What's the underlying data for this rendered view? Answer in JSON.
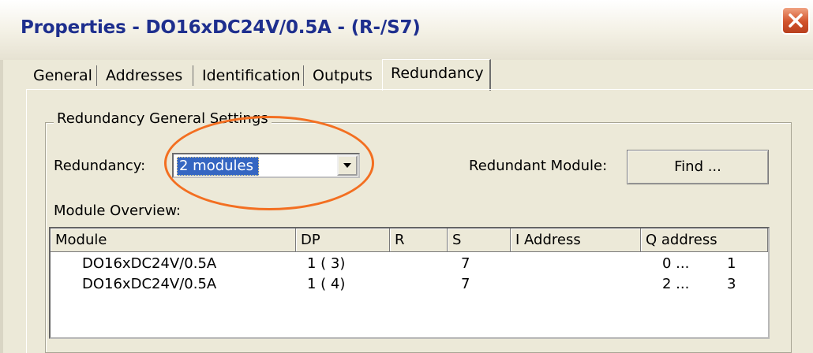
{
  "window": {
    "title": "Properties - DO16xDC24V/0.5A - (R-/S7)"
  },
  "tabs": [
    {
      "label": "General"
    },
    {
      "label": "Addresses"
    },
    {
      "label": "Identification"
    },
    {
      "label": "Outputs"
    },
    {
      "label": "Redundancy"
    }
  ],
  "active_tab": "Redundancy",
  "group": {
    "title": "Redundancy General Settings",
    "redundancy_label": "Redundancy:",
    "redundancy_value": "2 modules",
    "redundant_module_label": "Redundant Module:",
    "find_button": "Find ...",
    "overview_label": "Module Overview:"
  },
  "table": {
    "columns": [
      "Module",
      "DP",
      "R",
      "S",
      "I Address",
      "Q address"
    ],
    "rows": [
      {
        "module": "DO16xDC24V/0.5A",
        "dp": "1 ( 3)",
        "r": "",
        "s": "7",
        "i_address": "",
        "q_start": "0 ...",
        "q_end": "1"
      },
      {
        "module": "DO16xDC24V/0.5A",
        "dp": "1 ( 4)",
        "r": "",
        "s": "7",
        "i_address": "",
        "q_start": "2 ...",
        "q_end": "3"
      }
    ]
  },
  "colors": {
    "title_text": "#1e2f8e",
    "highlight": "#f36f21",
    "selection": "#3566c2",
    "close_button": "#d2532c"
  },
  "icons": {
    "close": "close-x-icon",
    "dropdown": "chevron-down-icon"
  }
}
